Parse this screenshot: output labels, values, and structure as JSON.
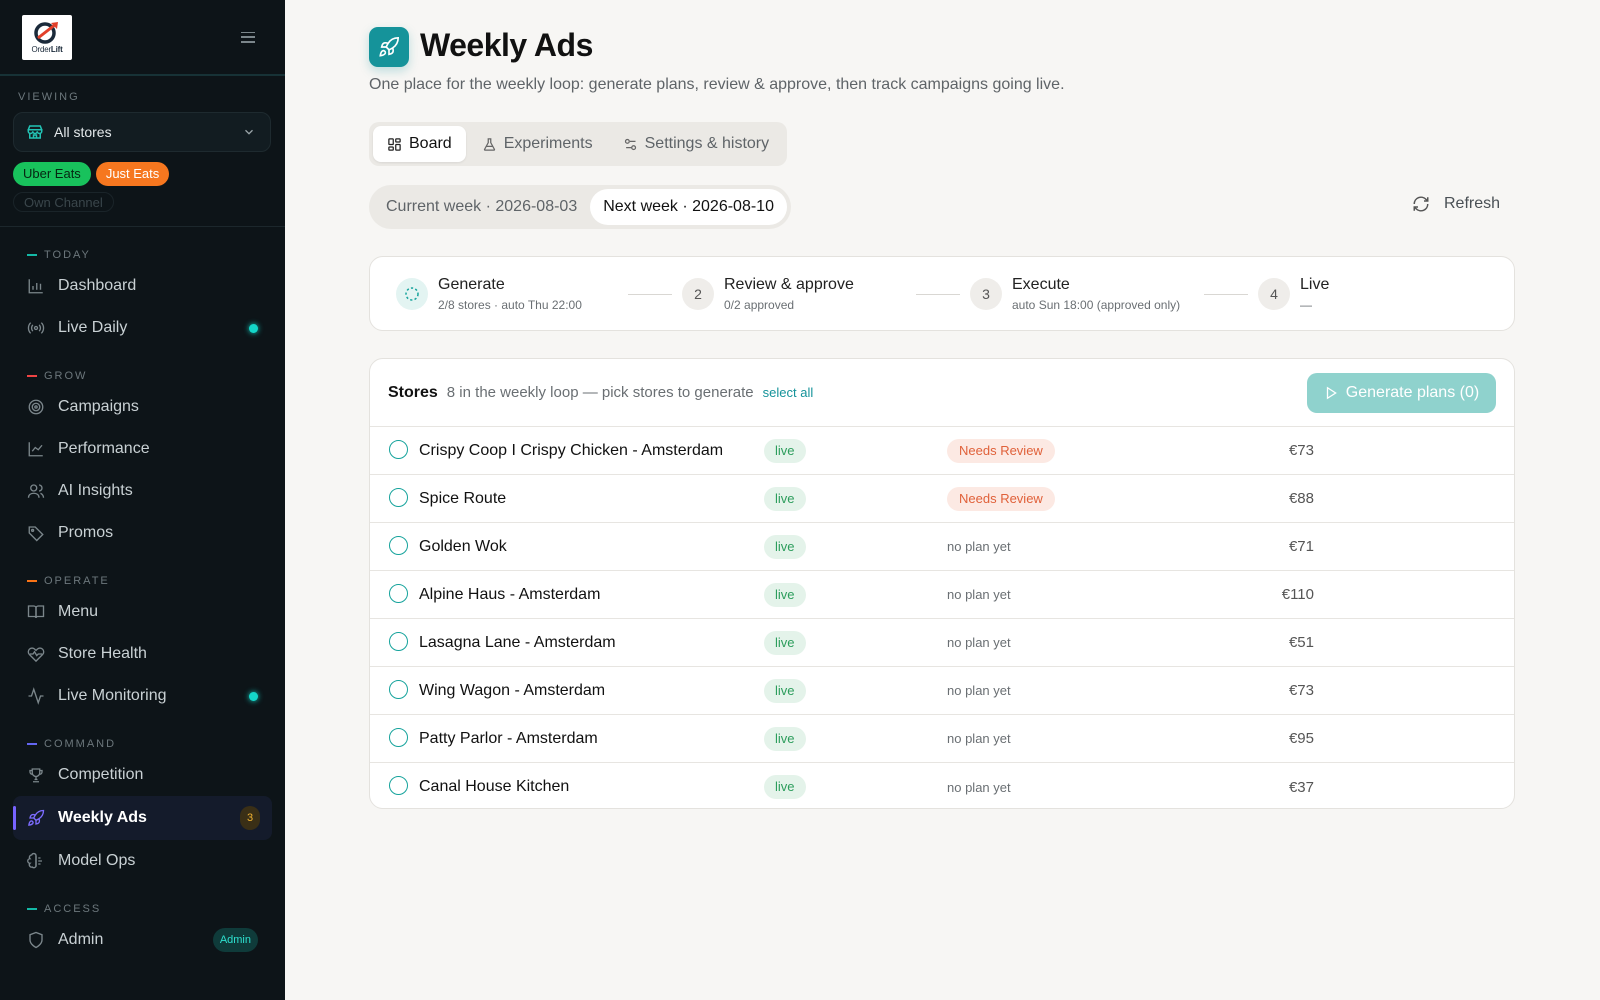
{
  "sidebar": {
    "logo_text_a": "Order",
    "logo_text_b": "Lift",
    "viewing_label": "VIEWING",
    "store_select": "All stores",
    "channels": {
      "uber": "Uber Eats",
      "just": "Just Eats",
      "own": "Own Channel"
    },
    "sections": {
      "today": "TODAY",
      "grow": "GROW",
      "operate": "OPERATE",
      "command": "COMMAND",
      "access": "ACCESS"
    },
    "section_colors": {
      "today": "#14b8a6",
      "grow": "#ef4444",
      "operate": "#f97316",
      "command": "#6366f1",
      "access": "#14b8a6"
    },
    "items": {
      "dashboard": "Dashboard",
      "live_daily": "Live Daily",
      "campaigns": "Campaigns",
      "performance": "Performance",
      "ai_insights": "AI Insights",
      "promos": "Promos",
      "menu": "Menu",
      "store_health": "Store Health",
      "live_monitoring": "Live Monitoring",
      "competition": "Competition",
      "weekly_ads": "Weekly Ads",
      "weekly_ads_count": "3",
      "model_ops": "Model Ops",
      "admin": "Admin",
      "admin_badge": "Admin"
    }
  },
  "header": {
    "title": "Weekly Ads",
    "subtitle": "One place for the weekly loop: generate plans, review & approve, then track campaigns going live."
  },
  "tabs": {
    "board": "Board",
    "experiments": "Experiments",
    "settings": "Settings & history",
    "active": "Board"
  },
  "weeks": {
    "current": "Current week · 2026-08-03",
    "next": "Next week · 2026-08-10",
    "active": "next"
  },
  "refresh_label": "Refresh",
  "stepper": [
    {
      "num": "",
      "title": "Generate",
      "sub": "2/8 stores · auto Thu 22:00"
    },
    {
      "num": "2",
      "title": "Review & approve",
      "sub": "0/2 approved"
    },
    {
      "num": "3",
      "title": "Execute",
      "sub": "auto Sun 18:00 (approved only)"
    },
    {
      "num": "4",
      "title": "Live",
      "sub": "—"
    }
  ],
  "stores": {
    "title": "Stores",
    "desc": "8 in the weekly loop — pick stores to generate",
    "select_all": "select all",
    "generate_button": "Generate plans (0)",
    "rows": [
      {
        "name": "Crispy Coop I Crispy Chicken - Amsterdam",
        "live": "live",
        "status": "Needs Review",
        "price": "€73"
      },
      {
        "name": "Spice Route",
        "live": "live",
        "status": "Needs Review",
        "price": "€88"
      },
      {
        "name": "Golden Wok",
        "live": "live",
        "status": "no plan yet",
        "price": "€71"
      },
      {
        "name": "Alpine Haus - Amsterdam",
        "live": "live",
        "status": "no plan yet",
        "price": "€110"
      },
      {
        "name": "Lasagna Lane - Amsterdam",
        "live": "live",
        "status": "no plan yet",
        "price": "€51"
      },
      {
        "name": "Wing Wagon - Amsterdam",
        "live": "live",
        "status": "no plan yet",
        "price": "€73"
      },
      {
        "name": "Patty Parlor - Amsterdam",
        "live": "live",
        "status": "no plan yet",
        "price": "€95"
      },
      {
        "name": "Canal House Kitchen",
        "live": "live",
        "status": "no plan yet",
        "price": "€37"
      }
    ]
  },
  "colors": {
    "accent": "#15939a",
    "sidebar_bg": "#0d1418",
    "needs_review": "#e0613a",
    "live_green": "#2c9d5c"
  }
}
